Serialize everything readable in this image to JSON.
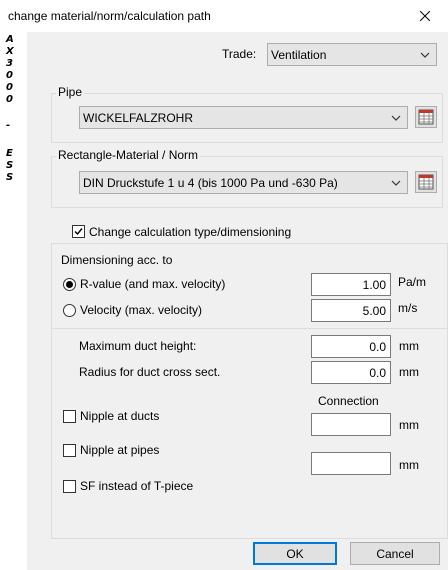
{
  "window": {
    "title": "change material/norm/calculation path"
  },
  "side_strip": {
    "letters": [
      "A",
      "X",
      "3",
      "0",
      "0",
      "0",
      "-",
      "E",
      "S",
      "S"
    ]
  },
  "trade": {
    "label": "Trade:",
    "value": "Ventilation"
  },
  "pipe": {
    "group_label": "Pipe",
    "value": "WICKELFALZROHR"
  },
  "rect": {
    "group_label": "Rectangle-Material / Norm",
    "value": "DIN Druckstufe 1 u 4 (bis 1000 Pa und -630 Pa)"
  },
  "change_calc": {
    "label": "Change calculation type/dimensioning",
    "checked": true
  },
  "dimensioning": {
    "group_label": "Dimensioning acc. to",
    "rvalue_label": "R-value (and max. velocity)",
    "rvalue_value": "1.00",
    "rvalue_unit": "Pa/m",
    "velocity_label": "Velocity (max. velocity)",
    "velocity_value": "5.00",
    "velocity_unit": "m/s",
    "selected": "rvalue",
    "max_height_label": "Maximum duct height:",
    "max_height_value": "0.0",
    "max_height_unit": "mm",
    "radius_label": "Radius for duct cross sect.",
    "radius_value": "0.0",
    "radius_unit": "mm",
    "connection_label": "Connection",
    "nipple_ducts_label": "Nipple at ducts",
    "nipple_ducts_value": "",
    "nipple_ducts_unit": "mm",
    "nipple_pipes_label": "Nipple at pipes",
    "nipple_pipes_value": "",
    "nipple_pipes_unit": "mm",
    "sf_label": "SF instead of T-piece"
  },
  "buttons": {
    "ok": "OK",
    "cancel": "Cancel"
  },
  "colors": {
    "accent": "#0078d7",
    "client_bg": "#f0f0f0"
  }
}
